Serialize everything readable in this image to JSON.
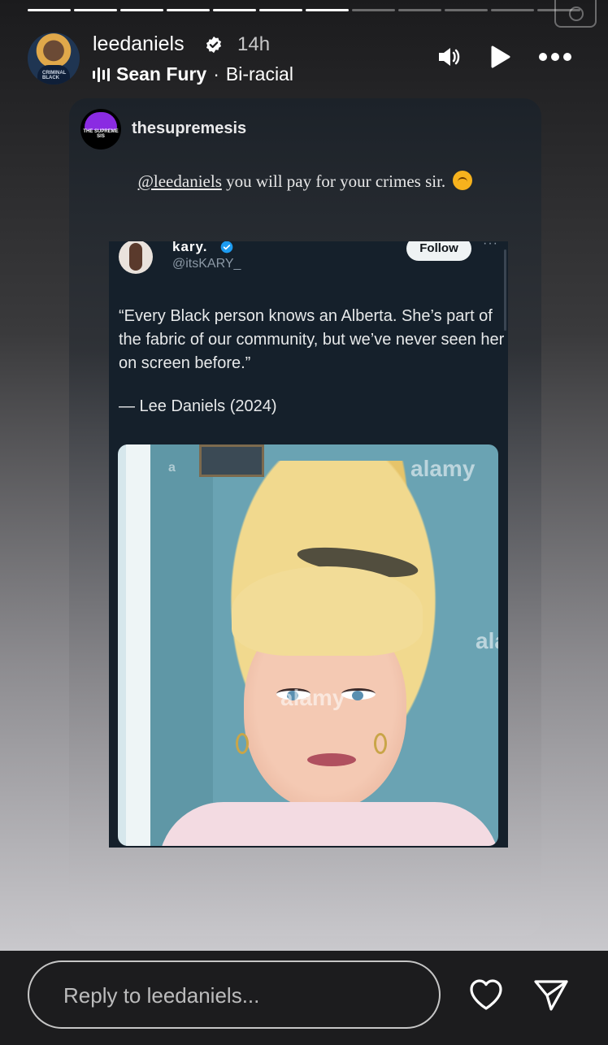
{
  "story": {
    "segments_total": 12,
    "segments_complete": 7,
    "username": "leedaniels",
    "time_ago": "14h",
    "music_artist": "Sean Fury",
    "music_separator": "·",
    "music_title": "Bi-racial"
  },
  "shared_post": {
    "username": "thesupremesis",
    "avatar_text": "THE SUPREME SIS",
    "mention": "@leedaniels",
    "caption": " you will pay for your crimes sir."
  },
  "tweet": {
    "display_name": "kary.",
    "handle": "@itsKARY_",
    "follow_label": "Follow",
    "more_label": "···",
    "quote": "“Every Black person knows an Alberta. She’s part of the fabric of our community, but we’ve never seen her on screen before.”",
    "attribution": "— Lee Daniels (2024)",
    "watermarks": [
      "alamy",
      "alamy",
      "ala",
      "a"
    ]
  },
  "footer": {
    "reply_placeholder": "Reply to leedaniels..."
  },
  "colors": {
    "verified_blue": "#1d9bf0",
    "tweet_bg": "#15202b"
  }
}
